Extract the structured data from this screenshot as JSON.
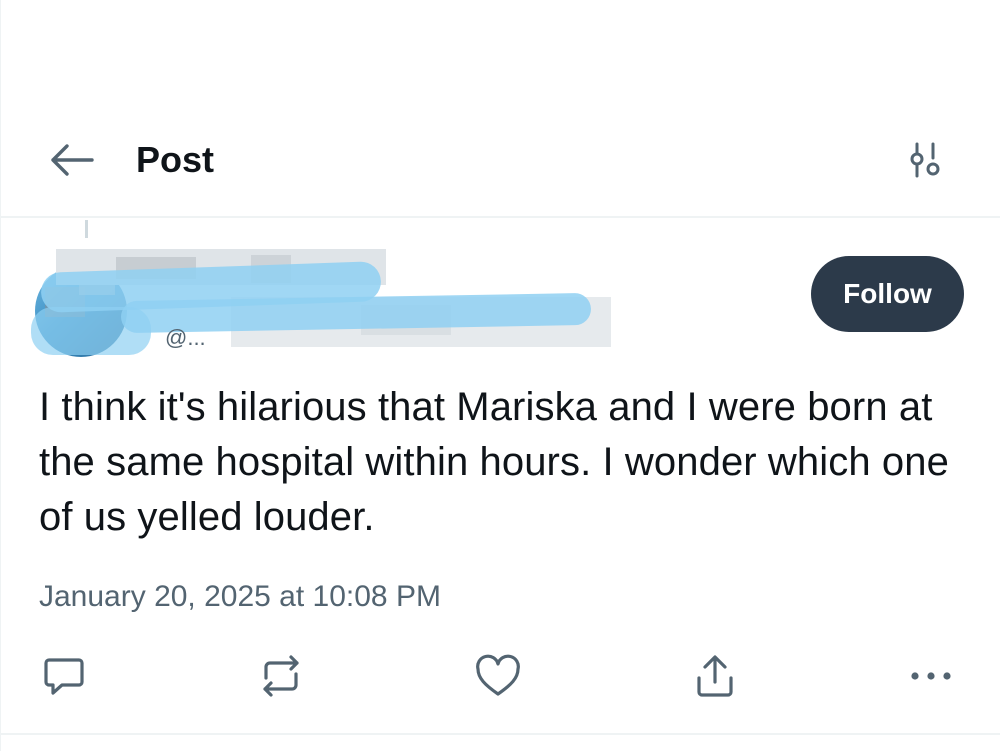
{
  "header": {
    "title": "Post",
    "back_icon": "arrow-left-icon",
    "filter_icon": "sliders-icon"
  },
  "author": {
    "handle_visible_fragment": "@..."
  },
  "follow_label": "Follow",
  "post": {
    "text": "I think it's hilarious that Mariska and I were born at the same hospital within hours. I wonder which one of us yelled louder.",
    "timestamp": "January 20, 2025 at 10:08 PM"
  },
  "actions": [
    {
      "icon": "reply-icon"
    },
    {
      "icon": "repost-icon"
    },
    {
      "icon": "like-icon"
    },
    {
      "icon": "share-icon"
    },
    {
      "icon": "more-icon"
    }
  ],
  "colors": {
    "text_primary": "#0f1419",
    "text_secondary": "#536471",
    "follow_bg": "#2c3a4a",
    "divider": "#eff3f4",
    "redaction_blue": "#8fd0f2"
  }
}
